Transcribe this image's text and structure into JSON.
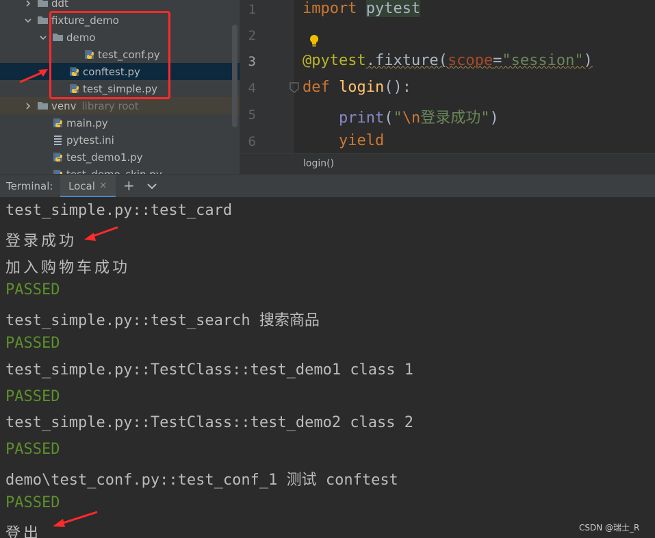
{
  "project_tree": {
    "items": [
      {
        "label": "ddt",
        "type": "folder",
        "expanded": false,
        "hint": ""
      },
      {
        "label": "fixture_demo",
        "type": "folder",
        "expanded": true,
        "hint": ""
      },
      {
        "label": "demo",
        "type": "folder",
        "expanded": true,
        "hint": ""
      },
      {
        "label": "test_conf.py",
        "type": "python",
        "hint": ""
      },
      {
        "label": "conftest.py",
        "type": "python",
        "hint": "",
        "selected": true
      },
      {
        "label": "test_simple.py",
        "type": "python",
        "hint": ""
      },
      {
        "label": "venv",
        "type": "folder",
        "expanded": false,
        "hint": "library root"
      },
      {
        "label": "main.py",
        "type": "python",
        "hint": ""
      },
      {
        "label": "pytest.ini",
        "type": "ini",
        "hint": ""
      },
      {
        "label": "test_demo1.py",
        "type": "python",
        "hint": ""
      },
      {
        "label": "test_demo_skip.py",
        "type": "python",
        "hint": ""
      }
    ]
  },
  "editor": {
    "line_numbers": [
      "1",
      "2",
      "3",
      "4",
      "5",
      "6"
    ],
    "current_line": "3",
    "code": {
      "l1_kw": "import",
      "l1_mod": "pytest",
      "l3_deco": "@pytest",
      "l3_attr": ".fixture(",
      "l3_param": "scope",
      "l3_eq": "=",
      "l3_str": "\"session\"",
      "l3_close": ")",
      "l4_kw": "def",
      "l4_fn": "login",
      "l4_rest": "():",
      "l5_builtin": "print",
      "l5_open": "(",
      "l5_str_open": "\"",
      "l5_esc": "\\n",
      "l5_str_text": "登录成功\"",
      "l5_close": ")",
      "l6_kw": "yield"
    },
    "breadcrumb": "login()"
  },
  "terminal": {
    "title": "Terminal:",
    "tab_label": "Local",
    "tab_close": "×",
    "add_label": "+",
    "lines": [
      {
        "text": "test_simple.py::test_card",
        "status": "normal"
      },
      {
        "text": "登录成功",
        "status": "cjk"
      },
      {
        "text": "加入购物车成功",
        "status": "cjk"
      },
      {
        "text": "PASSED",
        "status": "pass"
      },
      {
        "text": "test_simple.py::test_search 搜索商品",
        "status": "normal"
      },
      {
        "text": "PASSED",
        "status": "pass"
      },
      {
        "text": "test_simple.py::TestClass::test_demo1 class 1",
        "status": "normal"
      },
      {
        "text": "PASSED",
        "status": "pass"
      },
      {
        "text": "test_simple.py::TestClass::test_demo2 class 2",
        "status": "normal"
      },
      {
        "text": "PASSED",
        "status": "pass"
      },
      {
        "text": "demo\\test_conf.py::test_conf_1 测试 conftest",
        "status": "normal"
      },
      {
        "text": "PASSED",
        "status": "pass"
      },
      {
        "text": "登出",
        "status": "cjk"
      }
    ]
  },
  "watermark": "CSDN @瑞士_R",
  "colors": {
    "annotation": "#ff2a2a",
    "passed": "#5e8f2c",
    "selection": "#0d293e"
  },
  "icons": {
    "folder": "folder-icon",
    "python": "python-file-icon",
    "ini": "ini-file-icon",
    "bulb": "lightbulb-icon",
    "chevron_down": "chevron-down-icon",
    "chevron_right": "chevron-right-icon"
  }
}
